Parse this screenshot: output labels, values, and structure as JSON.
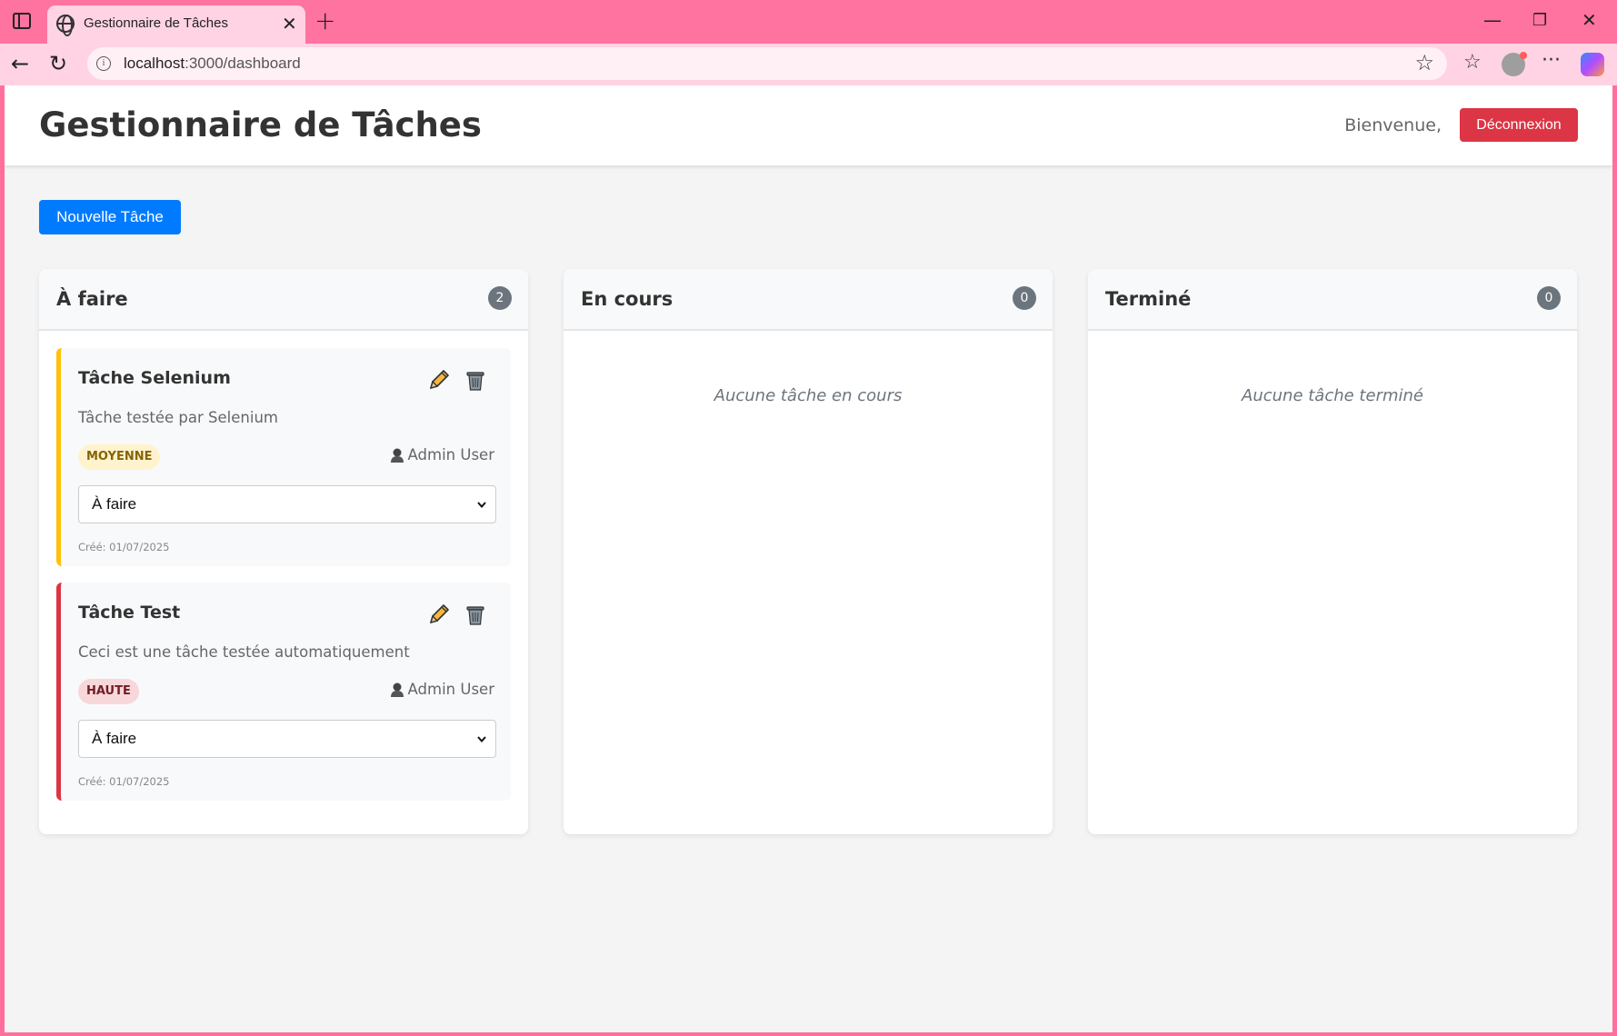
{
  "browser": {
    "tab_title": "Gestionnaire de Tâches",
    "url_host": "localhost",
    "url_path": ":3000/dashboard"
  },
  "header": {
    "title": "Gestionnaire de Tâches",
    "welcome": "Bienvenue,",
    "logout_label": "Déconnexion"
  },
  "actions": {
    "new_task_label": "Nouvelle Tâche"
  },
  "columns": [
    {
      "title": "À faire",
      "count": "2",
      "tasks": [
        {
          "title": "Tâche Selenium",
          "description": "Tâche testée par Selenium",
          "priority": "MOYENNE",
          "assignee": "Admin User",
          "status": "À faire",
          "created": "Créé: 01/07/2025"
        },
        {
          "title": "Tâche Test",
          "description": "Ceci est une tâche testée automatiquement",
          "priority": "HAUTE",
          "assignee": "Admin User",
          "status": "À faire",
          "created": "Créé: 01/07/2025"
        }
      ]
    },
    {
      "title": "En cours",
      "count": "0",
      "empty_text": "Aucune tâche en cours"
    },
    {
      "title": "Terminé",
      "count": "0",
      "empty_text": "Aucune tâche terminé"
    }
  ],
  "colors": {
    "primary": "#007bff",
    "danger": "#dc3545",
    "medium_priority": "#ffc107",
    "high_priority": "#dc3545",
    "browser_frame": "#ff73a0"
  }
}
